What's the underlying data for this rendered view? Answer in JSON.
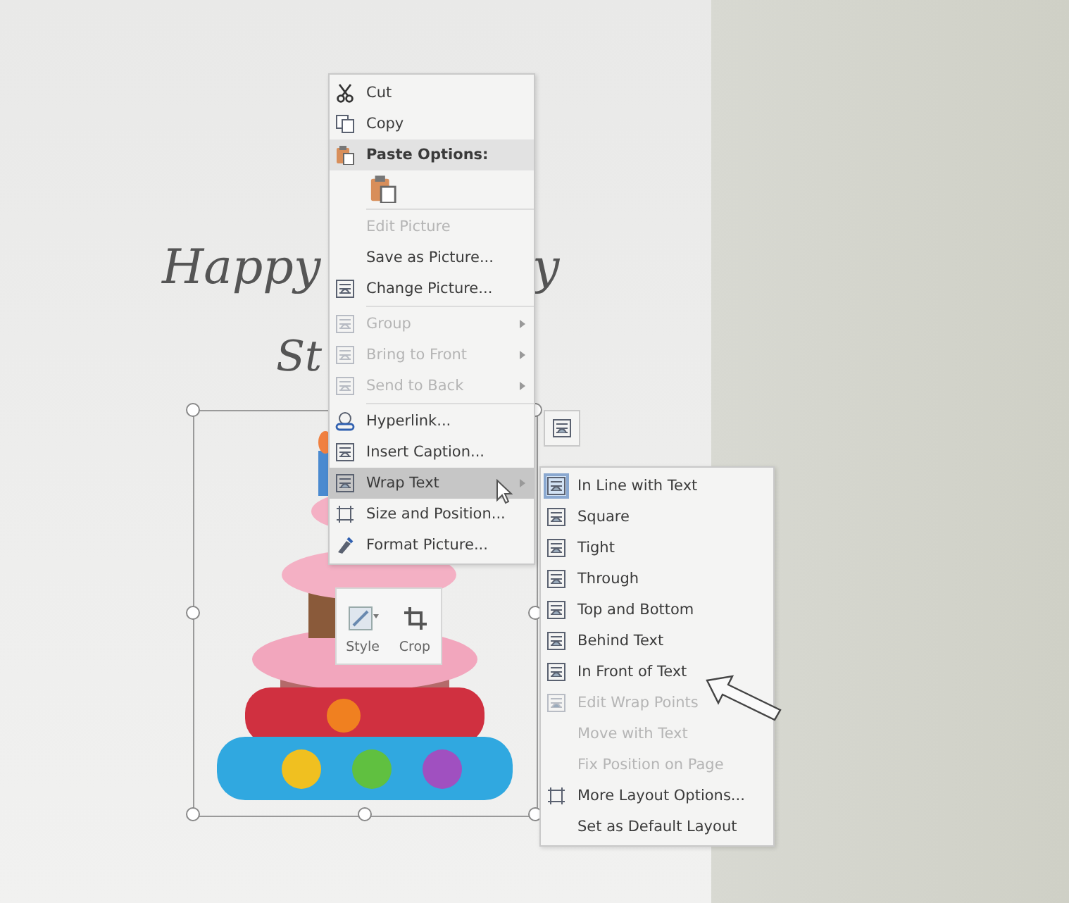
{
  "document": {
    "heading_parts": [
      "Happy",
      "y"
    ],
    "subheading": "St"
  },
  "picture": {
    "kind": "picture",
    "selected": true
  },
  "context_menu": {
    "groups": [
      [
        {
          "kind": "item",
          "label": "Cut",
          "disabled": false,
          "submenu": false,
          "highlighted": false
        },
        {
          "kind": "item",
          "label": "Copy",
          "disabled": false,
          "submenu": false,
          "highlighted": false
        },
        {
          "kind": "header",
          "label": "Paste Options:"
        },
        {
          "kind": "paste"
        }
      ],
      [
        {
          "kind": "item",
          "label": "Edit Picture",
          "disabled": true,
          "submenu": false,
          "highlighted": false
        },
        {
          "kind": "item",
          "label": "Save as Picture...",
          "disabled": false,
          "submenu": false,
          "highlighted": false
        },
        {
          "kind": "item",
          "label": "Change Picture...",
          "disabled": false,
          "submenu": false,
          "highlighted": false
        }
      ],
      [
        {
          "kind": "item",
          "label": "Group",
          "disabled": true,
          "submenu": true,
          "highlighted": false
        },
        {
          "kind": "item",
          "label": "Bring to Front",
          "disabled": true,
          "submenu": true,
          "highlighted": false
        },
        {
          "kind": "item",
          "label": "Send to Back",
          "disabled": true,
          "submenu": true,
          "highlighted": false
        }
      ],
      [
        {
          "kind": "item",
          "label": "Hyperlink...",
          "disabled": false,
          "submenu": false,
          "highlighted": false
        },
        {
          "kind": "item",
          "label": "Insert Caption...",
          "disabled": false,
          "submenu": false,
          "highlighted": false
        },
        {
          "kind": "item",
          "label": "Wrap Text",
          "disabled": false,
          "submenu": true,
          "highlighted": true
        },
        {
          "kind": "item",
          "label": "Size and Position...",
          "disabled": false,
          "submenu": false,
          "highlighted": false
        },
        {
          "kind": "item",
          "label": "Format Picture...",
          "disabled": false,
          "submenu": false,
          "highlighted": false
        }
      ]
    ]
  },
  "wrap_submenu": {
    "items": [
      {
        "label": "In Line with Text",
        "disabled": false,
        "selected": true
      },
      {
        "label": "Square",
        "disabled": false,
        "selected": false
      },
      {
        "label": "Tight",
        "disabled": false,
        "selected": false
      },
      {
        "label": "Through",
        "disabled": false,
        "selected": false
      },
      {
        "label": "Top and Bottom",
        "disabled": false,
        "selected": false
      },
      {
        "label": "Behind Text",
        "disabled": false,
        "selected": false
      },
      {
        "label": "In Front of Text",
        "disabled": false,
        "selected": false
      },
      {
        "label": "Edit Wrap Points",
        "disabled": true,
        "selected": false
      },
      {
        "label": "Move with Text",
        "disabled": true,
        "selected": false
      },
      {
        "label": "Fix Position on Page",
        "disabled": true,
        "selected": false
      },
      {
        "label": "More Layout Options...",
        "disabled": false,
        "selected": false
      },
      {
        "label": "Set as Default Layout",
        "disabled": false,
        "selected": false
      }
    ]
  },
  "mini_toolbar": {
    "buttons": [
      "Style",
      "Crop"
    ]
  }
}
